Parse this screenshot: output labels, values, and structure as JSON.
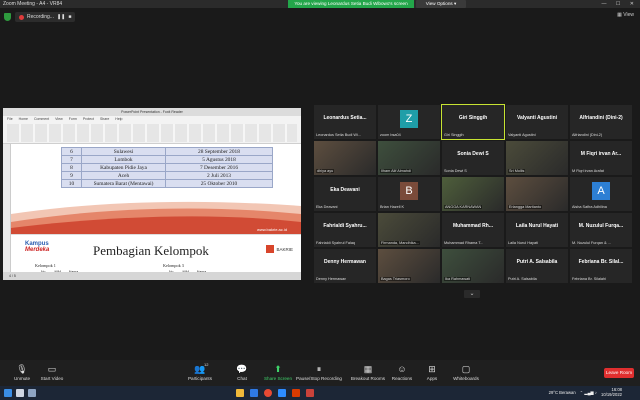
{
  "window": {
    "title": "Zoom Meeting - A4 - VR84",
    "controls": "— ☐ ✕"
  },
  "banner": {
    "viewing": "You are viewing Leonardus Setia Budi Wibowo's screen",
    "view_options": "View Options ▾"
  },
  "recording": {
    "label": "Recording...",
    "pause": "❚❚",
    "stop": "■"
  },
  "view_button": "▦ View",
  "shared": {
    "pp_title": "PowerPoint Presentation - Foxit Reader",
    "ribbon_tabs": [
      "File",
      "Home",
      "Comment",
      "View",
      "Form",
      "Protect",
      "Share",
      "Help"
    ],
    "table": [
      [
        "6",
        "Sulawesi",
        "28 September 2018"
      ],
      [
        "7",
        "Lombok",
        "5 Agustus 2018"
      ],
      [
        "8",
        "Kabupaten Pidie Jaya",
        "7 Desember 2016"
      ],
      [
        "9",
        "Aceh",
        "2 Juli 2013"
      ],
      [
        "10",
        "Sumatera Barat (Mentawai)",
        "25 Oktober 2010"
      ]
    ],
    "url": "www.bakrie.ac.id",
    "kampus_line1": "Kampus",
    "kampus_line2": "Merdeka",
    "slide_title": "Pembagian Kelompok",
    "bakrie": "BAKRIE",
    "kelompok1": "Kelompok 1",
    "kelompok3": "Kelompok 3",
    "col_no": "No.",
    "col_nim": "NIM",
    "col_nama": "Nama",
    "status": "4 / 5"
  },
  "participants": [
    {
      "caption": "Leonardus  Setia...",
      "bottom": "Leonardus Setia Budi Wi...",
      "type": "name"
    },
    {
      "caption": "Z",
      "bottom": "zoom bsa04",
      "type": "avatar",
      "color": "#1f9ea8"
    },
    {
      "caption": "Giri Singgih",
      "bottom": "Giri Singgih",
      "type": "name",
      "highlight": true
    },
    {
      "caption": "Valyanti Agustini",
      "bottom": "Valyanti Agustini",
      "type": "name"
    },
    {
      "caption": "Alfriandini (Dini-2)",
      "bottom": "Alfriandini (Dini-2)",
      "type": "name"
    },
    {
      "caption": "",
      "bottom": "dhiya ayu",
      "type": "video"
    },
    {
      "caption": "",
      "bottom": "Ilham Alif Almahdi",
      "type": "video"
    },
    {
      "caption": "Sonia Dewi S",
      "bottom": "Sonia Dewi S",
      "type": "name"
    },
    {
      "caption": "",
      "bottom": "Sri Mollis",
      "type": "video"
    },
    {
      "caption": "M Fiqri irvan Ar...",
      "bottom": "M Fiqri irvan Arafat",
      "type": "name"
    },
    {
      "caption": "Eka Deavani",
      "bottom": "Eka Deavani",
      "type": "name"
    },
    {
      "caption": "B",
      "bottom": "Brian Hazell K",
      "type": "avatar",
      "color": "#7a4b3a"
    },
    {
      "caption": "",
      "bottom": "ANGGA KARNAWAN",
      "type": "video"
    },
    {
      "caption": "",
      "bottom": "Erlangga Martianto",
      "type": "video"
    },
    {
      "caption": "A",
      "bottom": "Aisha Safira Adhilina",
      "type": "avatar",
      "color": "#2d7fd4"
    },
    {
      "caption": "Fahrialdi  Syahru...",
      "bottom": "Fahrialdi Syahrul Falaq",
      "type": "name"
    },
    {
      "caption": "",
      "bottom": "Firmanda, Mandhika...",
      "type": "video"
    },
    {
      "caption": "Muhammad  Rh...",
      "bottom": "Muhammad Rhama T...",
      "type": "name"
    },
    {
      "caption": "Laila Nurul Hayati",
      "bottom": "Laila Nurul Hayati",
      "type": "name"
    },
    {
      "caption": "M.  Nuzulul  Furqa...",
      "bottom": "M. Nuzulul Furqan & ...",
      "type": "name"
    },
    {
      "caption": "Denny Hermawan",
      "bottom": "Denny Hermawan",
      "type": "name"
    },
    {
      "caption": "",
      "bottom": "Bagas Triasmoro",
      "type": "video"
    },
    {
      "caption": "",
      "bottom": "Ika Rahmawati",
      "type": "video"
    },
    {
      "caption": "Putri A. Salsabila",
      "bottom": "Putri A. Salsabila",
      "type": "name"
    },
    {
      "caption": "Febriana  Br.  Silal...",
      "bottom": "Febriana Br. Silalahi",
      "type": "name"
    }
  ],
  "gallery_next": "⌄",
  "toolbar": {
    "unmute": "Unmute",
    "start_video": "Start Video",
    "participants": "Participants",
    "participants_count": "12",
    "chat": "Chat",
    "share_screen": "Share Screen",
    "pause_recording": "Pause/Stop Recording",
    "breakout": "Breakout Rooms",
    "reactions": "Reactions",
    "apps": "Apps",
    "whiteboards": "Whiteboards",
    "leave": "Leave Room"
  },
  "taskbar": {
    "weather": "29°C  Berawan",
    "time": "16:08",
    "date": "10/19/2022"
  }
}
